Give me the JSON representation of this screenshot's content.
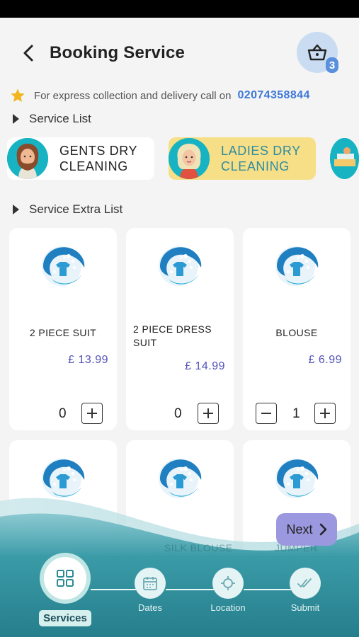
{
  "header": {
    "title": "Booking Service",
    "cart_count": "3"
  },
  "express": {
    "text": "For express collection and delivery call on",
    "phone": "02074358844"
  },
  "sections": {
    "service_list": "Service List",
    "service_extra_list": "Service Extra List"
  },
  "services": [
    {
      "line1": "GENTS DRY",
      "line2": "CLEANING"
    },
    {
      "line1": "LADIES DRY",
      "line2": "CLEANING"
    }
  ],
  "products": [
    {
      "name": "2 PIECE SUIT",
      "price": "£  13.99",
      "qty": "0"
    },
    {
      "name": "2 PIECE DRESS SUIT",
      "price": "£  14.99",
      "qty": "0"
    },
    {
      "name": "BLOUSE",
      "price": "£  6.99",
      "qty": "1"
    },
    {
      "name": "SILK BLOUSE"
    },
    {
      "name": "JUMPER"
    }
  ],
  "next_label": "Next",
  "steps": {
    "services": "Services",
    "dates": "Dates",
    "location": "Location",
    "submit": "Submit"
  },
  "colors": {
    "accent": "#3f78d8",
    "price": "#5252b8",
    "highlight_card": "#f6df87",
    "teal": "#2a8f9b"
  }
}
